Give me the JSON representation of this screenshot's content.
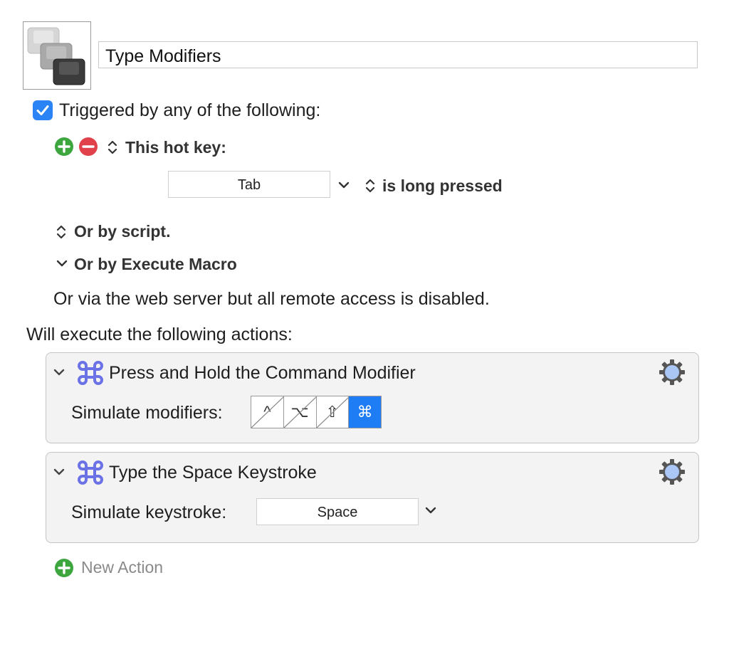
{
  "macro": {
    "name": "Type Modifiers"
  },
  "triggers": {
    "enabled_label": "Triggered by any of the following:",
    "hotkey_label": "This hot key:",
    "hotkey_value": "Tab",
    "hotkey_condition": "is long pressed",
    "script_label": "Or by script.",
    "execute_macro_label": "Or by Execute Macro",
    "web_server_text": "Or via the web server but all remote access is disabled."
  },
  "actions_header": "Will execute the following actions:",
  "actions": [
    {
      "title": "Press and Hold the Command Modifier",
      "field_label": "Simulate modifiers:",
      "modifiers": [
        {
          "symbol": "^",
          "name": "control",
          "on": false
        },
        {
          "symbol": "⌥",
          "name": "option",
          "on": false
        },
        {
          "symbol": "⇧",
          "name": "shift",
          "on": false
        },
        {
          "symbol": "⌘",
          "name": "command",
          "on": true
        }
      ]
    },
    {
      "title": "Type the Space Keystroke",
      "field_label": "Simulate keystroke:",
      "value": "Space"
    }
  ],
  "new_action_label": "New Action",
  "colors": {
    "accent": "#2a84f5",
    "add": "#3ea63f",
    "remove": "#e0414a",
    "command_icon": "#6b72e6"
  },
  "icons": [
    "macro-group-icon",
    "checkbox-icon",
    "add-icon",
    "remove-icon",
    "updown-chevron-icon",
    "chevron-down-icon",
    "command-icon",
    "gear-icon"
  ]
}
